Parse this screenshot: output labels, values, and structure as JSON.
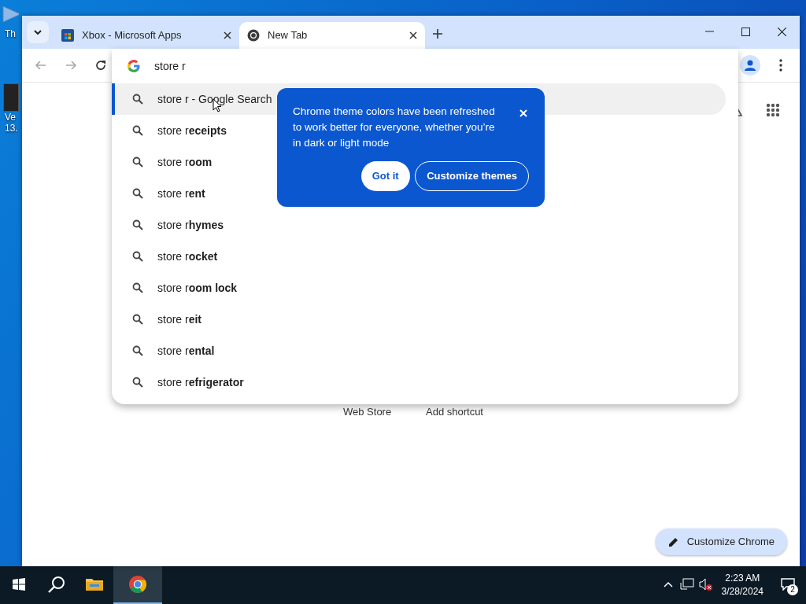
{
  "desktop_icons": [
    {
      "lines": [
        "Th"
      ]
    },
    {
      "lines": [
        "Ve",
        "13."
      ]
    }
  ],
  "browser": {
    "tabs": [
      {
        "title": "Xbox - Microsoft Apps",
        "kind": "store",
        "selected": false
      },
      {
        "title": "New Tab",
        "kind": "chrome",
        "selected": true
      }
    ],
    "nav_buttons": [
      {
        "kind": "back",
        "disabled": true
      },
      {
        "kind": "forward",
        "disabled": true
      },
      {
        "kind": "reload",
        "disabled": false
      }
    ],
    "omnibox": {
      "value": "store r",
      "suggestions": [
        {
          "text": "store r - Google Search",
          "selected": true
        },
        {
          "text": "store r**eceipts**",
          "selected": false
        },
        {
          "text": "store r**oom**",
          "selected": false
        },
        {
          "text": "store r**ent**",
          "selected": false
        },
        {
          "text": "store r**hymes**",
          "selected": false
        },
        {
          "text": "store r**ocket**",
          "selected": false
        },
        {
          "text": "store r**oom lock**",
          "selected": false
        },
        {
          "text": "store r**eit**",
          "selected": false
        },
        {
          "text": "store r**ental**",
          "selected": false
        },
        {
          "text": "store r**efrigerator**",
          "selected": false
        }
      ]
    },
    "promo": {
      "message": "Chrome theme colors have been refreshed to work better for everyone, whether you’re in dark or light mode",
      "buttons": [
        "Got it",
        "Customize themes"
      ]
    },
    "shortcuts": [
      {
        "title": "Web Store"
      },
      {
        "title": "Add shortcut"
      }
    ],
    "customize_button": "Customize Chrome"
  },
  "taskbar": {
    "apps": [
      {
        "kind": "explorer",
        "active": false
      },
      {
        "kind": "chrome",
        "active": true
      }
    ],
    "time": "2:23 AM",
    "date": "3/28/2024",
    "notifications": "2"
  }
}
